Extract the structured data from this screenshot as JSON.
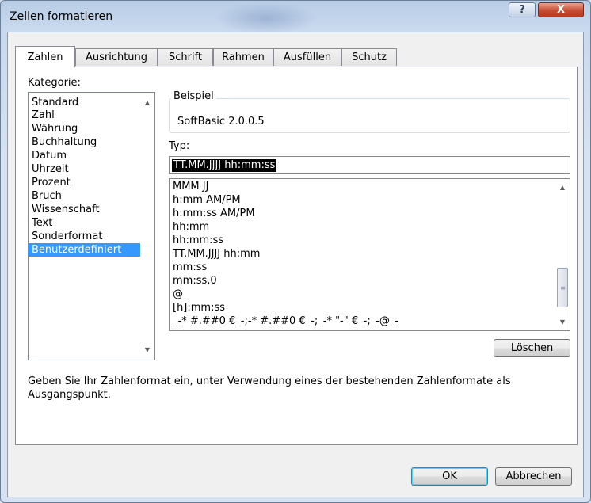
{
  "window": {
    "title": "Zellen formatieren",
    "help_label": "?",
    "close_label": "X"
  },
  "tabs": [
    {
      "label": "Zahlen",
      "active": true
    },
    {
      "label": "Ausrichtung",
      "active": false
    },
    {
      "label": "Schrift",
      "active": false
    },
    {
      "label": "Rahmen",
      "active": false
    },
    {
      "label": "Ausfüllen",
      "active": false
    },
    {
      "label": "Schutz",
      "active": false
    }
  ],
  "category": {
    "label": "Kategorie:",
    "items": [
      "Standard",
      "Zahl",
      "Währung",
      "Buchhaltung",
      "Datum",
      "Uhrzeit",
      "Prozent",
      "Bruch",
      "Wissenschaft",
      "Text",
      "Sonderformat",
      "Benutzerdefiniert"
    ],
    "selected": "Benutzerdefiniert"
  },
  "sample": {
    "legend": "Beispiel",
    "value": "SoftBasic 2.0.0.5"
  },
  "type": {
    "label": "Typ:",
    "value": "TT.MM.JJJJ hh:mm:ss"
  },
  "formats": [
    "MMM JJ",
    "h:mm AM/PM",
    "h:mm:ss AM/PM",
    "hh:mm",
    "hh:mm:ss",
    "TT.MM.JJJJ hh:mm",
    "mm:ss",
    "mm:ss,0",
    "@",
    "[h]:mm:ss",
    "_-* #.##0 €_-;-* #.##0 €_-;_-* \"-\" €_-;_-@_-"
  ],
  "buttons": {
    "delete": "Löschen",
    "ok": "OK",
    "cancel": "Abbrechen"
  },
  "description": "Geben Sie Ihr Zahlenformat ein, unter Verwendung eines der bestehenden Zahlenformate als Ausgangspunkt.",
  "icons": {
    "scroll_up": "scroll-up-icon",
    "scroll_down": "scroll-down-icon"
  }
}
